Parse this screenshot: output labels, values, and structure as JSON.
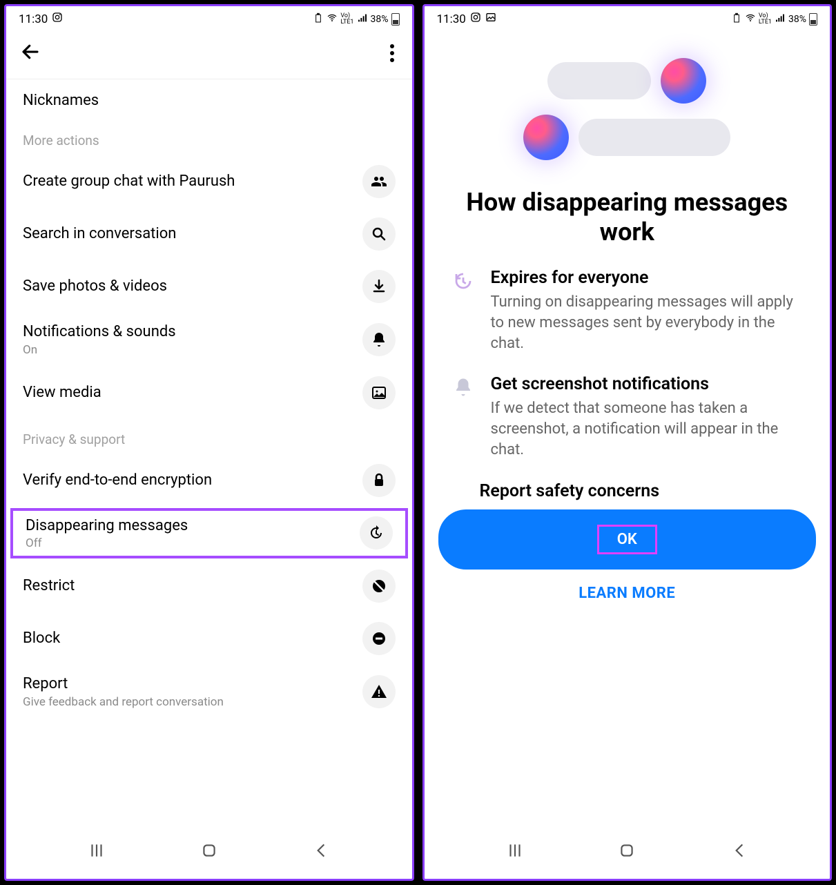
{
  "left": {
    "statusTime": "11:30",
    "battery": "38%",
    "sections": {
      "nicknames": "Nicknames",
      "moreActions": "More actions",
      "privacy": "Privacy & support"
    },
    "rows": {
      "createGroup": "Create group chat with Paurush",
      "search": "Search in conversation",
      "savePhotos": "Save photos & videos",
      "notifications": {
        "title": "Notifications & sounds",
        "sub": "On"
      },
      "viewMedia": "View media",
      "verify": "Verify end-to-end encryption",
      "disappearing": {
        "title": "Disappearing messages",
        "sub": "Off"
      },
      "restrict": "Restrict",
      "block": "Block",
      "report": {
        "title": "Report",
        "sub": "Give feedback and report conversation"
      }
    }
  },
  "right": {
    "statusTime": "11:30",
    "battery": "38%",
    "title": "How disappearing messages work",
    "items": {
      "expires": {
        "head": "Expires for everyone",
        "text": "Turning on disappearing messages will apply to new messages sent by everybody in the chat."
      },
      "screenshot": {
        "head": "Get screenshot notifications",
        "text": "If we detect that someone has taken a screenshot, a notification will appear in the chat."
      },
      "partial": "Report safety concerns"
    },
    "okLabel": "OK",
    "learnMore": "LEARN MORE"
  }
}
